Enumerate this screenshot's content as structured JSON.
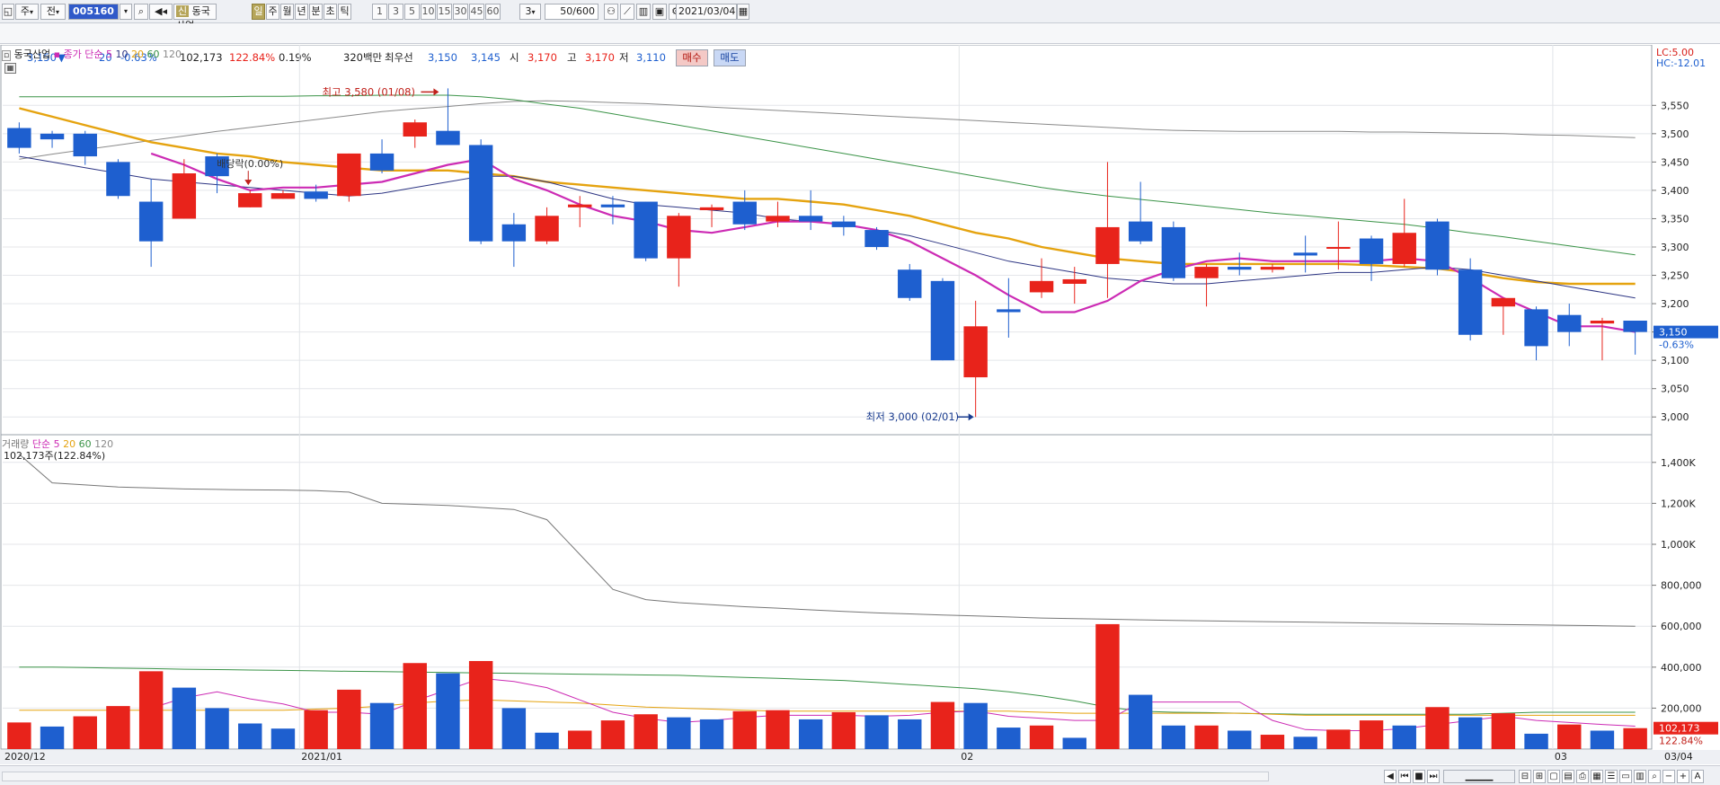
{
  "toolbar": {
    "mode_label": "주",
    "compare_label": "전",
    "stock_code": "005160",
    "sin_label": "신",
    "stock_name": "동국산업",
    "periods": [
      "일",
      "주",
      "월",
      "년",
      "분",
      "초",
      "틱"
    ],
    "active_period": "일",
    "intervals": [
      "1",
      "3",
      "5",
      "10",
      "15",
      "30",
      "45",
      "60"
    ],
    "interval_select": "3",
    "count_value": "50",
    "count_total": "/600",
    "date": "2021/03/04"
  },
  "quote": {
    "price": "3,150",
    "change_arrow": "▼",
    "change": "20",
    "change_pct": "-0.63%",
    "volume": "102,173",
    "volume_ratio": "122.84%",
    "turnover_rate": "0.19%",
    "amount": "320백만",
    "best_label": "최우선",
    "best_ask": "3,150",
    "best_bid": "3,145",
    "open_label": "시",
    "open": "3,170",
    "high_label": "고",
    "high": "3,170",
    "low_label": "저",
    "low": "3,110",
    "buy_label": "매수",
    "sell_label": "매도"
  },
  "price_panel": {
    "legend_name": "동국산업",
    "legend_type": "종가 단순",
    "ma_periods": [
      "5",
      "10",
      "20",
      "60",
      "120"
    ],
    "lc": "LC:5.00",
    "hc": "HC:-12.01",
    "current_price": "3,150",
    "current_change": "-0.63%",
    "high_annot": "최고 3,580 (01/08)",
    "low_annot": "최저 3,000 (02/01)",
    "ex_rights_annot": "배당락(0.00%)"
  },
  "volume_panel": {
    "legend_name": "거래량",
    "legend_type": "단순",
    "ma_periods": [
      "5",
      "20",
      "60",
      "120"
    ],
    "volume_info": "102,173주(122.84%)",
    "current_volume": "102,173",
    "current_ratio": "122.84%"
  },
  "x_axis": {
    "labels": [
      "2020/12",
      "2021/01",
      "02",
      "03"
    ],
    "end_label": "03/04"
  },
  "colors": {
    "up": "#e8231b",
    "down": "#1e5fcf",
    "ma5": "#cc2bb4",
    "ma10": "#2d3583",
    "ma20": "#e5a30f",
    "ma60": "#3a9347",
    "ma120": "#8a8a8a"
  },
  "chart_data": [
    {
      "type": "candlestick",
      "title": "동국산업",
      "ylim": [
        2975,
        3625
      ],
      "yticks": [
        3000,
        3050,
        3100,
        3150,
        3200,
        3250,
        3300,
        3350,
        3400,
        3450,
        3500,
        3550
      ],
      "candles": [
        {
          "o": 3510,
          "h": 3520,
          "l": 3465,
          "c": 3475
        },
        {
          "o": 3500,
          "h": 3505,
          "l": 3475,
          "c": 3490
        },
        {
          "o": 3500,
          "h": 3505,
          "l": 3445,
          "c": 3460
        },
        {
          "o": 3450,
          "h": 3455,
          "l": 3385,
          "c": 3390
        },
        {
          "o": 3380,
          "h": 3420,
          "l": 3265,
          "c": 3310
        },
        {
          "o": 3350,
          "h": 3455,
          "l": 3350,
          "c": 3430
        },
        {
          "o": 3460,
          "h": 3465,
          "l": 3395,
          "c": 3425
        },
        {
          "o": 3370,
          "h": 3400,
          "l": 3370,
          "c": 3395
        },
        {
          "o": 3385,
          "h": 3400,
          "l": 3385,
          "c": 3395
        },
        {
          "o": 3398,
          "h": 3410,
          "l": 3380,
          "c": 3385
        },
        {
          "o": 3390,
          "h": 3465,
          "l": 3380,
          "c": 3465
        },
        {
          "o": 3465,
          "h": 3490,
          "l": 3430,
          "c": 3435
        },
        {
          "o": 3495,
          "h": 3525,
          "l": 3475,
          "c": 3520
        },
        {
          "o": 3505,
          "h": 3580,
          "l": 3490,
          "c": 3480
        },
        {
          "o": 3480,
          "h": 3490,
          "l": 3305,
          "c": 3310
        },
        {
          "o": 3340,
          "h": 3360,
          "l": 3265,
          "c": 3310
        },
        {
          "o": 3310,
          "h": 3370,
          "l": 3305,
          "c": 3355
        },
        {
          "o": 3370,
          "h": 3390,
          "l": 3335,
          "c": 3375
        },
        {
          "o": 3375,
          "h": 3390,
          "l": 3340,
          "c": 3370
        },
        {
          "o": 3380,
          "h": 3380,
          "l": 3275,
          "c": 3280
        },
        {
          "o": 3280,
          "h": 3360,
          "l": 3230,
          "c": 3355
        },
        {
          "o": 3365,
          "h": 3375,
          "l": 3335,
          "c": 3370
        },
        {
          "o": 3380,
          "h": 3400,
          "l": 3330,
          "c": 3340
        },
        {
          "o": 3345,
          "h": 3380,
          "l": 3335,
          "c": 3355
        },
        {
          "o": 3355,
          "h": 3400,
          "l": 3330,
          "c": 3345
        },
        {
          "o": 3345,
          "h": 3355,
          "l": 3320,
          "c": 3335
        },
        {
          "o": 3330,
          "h": 3335,
          "l": 3295,
          "c": 3300
        },
        {
          "o": 3260,
          "h": 3270,
          "l": 3205,
          "c": 3210
        },
        {
          "o": 3240,
          "h": 3245,
          "l": 3100,
          "c": 3100
        },
        {
          "o": 3070,
          "h": 3205,
          "l": 3000,
          "c": 3160
        },
        {
          "o": 3190,
          "h": 3245,
          "l": 3140,
          "c": 3185
        },
        {
          "o": 3220,
          "h": 3280,
          "l": 3210,
          "c": 3240
        },
        {
          "o": 3235,
          "h": 3265,
          "l": 3200,
          "c": 3243
        },
        {
          "o": 3270,
          "h": 3450,
          "l": 3210,
          "c": 3335
        },
        {
          "o": 3345,
          "h": 3415,
          "l": 3305,
          "c": 3310
        },
        {
          "o": 3335,
          "h": 3345,
          "l": 3240,
          "c": 3245
        },
        {
          "o": 3245,
          "h": 3270,
          "l": 3195,
          "c": 3265
        },
        {
          "o": 3265,
          "h": 3290,
          "l": 3250,
          "c": 3260
        },
        {
          "o": 3260,
          "h": 3270,
          "l": 3255,
          "c": 3265
        },
        {
          "o": 3290,
          "h": 3320,
          "l": 3255,
          "c": 3285
        },
        {
          "o": 3300,
          "h": 3345,
          "l": 3260,
          "c": 3300
        },
        {
          "o": 3315,
          "h": 3320,
          "l": 3240,
          "c": 3270
        },
        {
          "o": 3270,
          "h": 3385,
          "l": 3265,
          "c": 3325
        },
        {
          "o": 3345,
          "h": 3350,
          "l": 3250,
          "c": 3260
        },
        {
          "o": 3260,
          "h": 3280,
          "l": 3135,
          "c": 3145
        },
        {
          "o": 3195,
          "h": 3210,
          "l": 3145,
          "c": 3210
        },
        {
          "o": 3190,
          "h": 3195,
          "l": 3100,
          "c": 3125
        },
        {
          "o": 3180,
          "h": 3200,
          "l": 3125,
          "c": 3150
        },
        {
          "o": 3165,
          "h": 3175,
          "l": 3100,
          "c": 3170
        },
        {
          "o": 3170,
          "h": 3170,
          "l": 3110,
          "c": 3150
        }
      ],
      "ma5": [
        null,
        null,
        null,
        null,
        3465,
        3445,
        3420,
        3400,
        3405,
        3405,
        3410,
        3415,
        3430,
        3445,
        3455,
        3420,
        3400,
        3375,
        3355,
        3345,
        3330,
        3325,
        3335,
        3345,
        3345,
        3340,
        3330,
        3310,
        3280,
        3250,
        3215,
        3185,
        3185,
        3205,
        3240,
        3260,
        3275,
        3280,
        3275,
        3275,
        3275,
        3275,
        3280,
        3275,
        3245,
        3210,
        3185,
        3160,
        3160,
        3150
      ],
      "ma10": [
        3460,
        3450,
        3440,
        3430,
        3420,
        3415,
        3410,
        3405,
        3400,
        3395,
        3390,
        3395,
        3405,
        3415,
        3425,
        3425,
        3415,
        3400,
        3385,
        3375,
        3370,
        3365,
        3360,
        3350,
        3345,
        3340,
        3330,
        3320,
        3305,
        3290,
        3275,
        3265,
        3255,
        3245,
        3240,
        3235,
        3235,
        3240,
        3245,
        3250,
        3255,
        3255,
        3260,
        3265,
        3260,
        3250,
        3240,
        3230,
        3220,
        3210
      ],
      "ma20": [
        3545,
        3530,
        3515,
        3500,
        3485,
        3475,
        3465,
        3460,
        3450,
        3445,
        3440,
        3435,
        3435,
        3435,
        3430,
        3425,
        3415,
        3410,
        3405,
        3400,
        3395,
        3390,
        3385,
        3385,
        3380,
        3375,
        3365,
        3355,
        3340,
        3325,
        3315,
        3300,
        3290,
        3280,
        3275,
        3270,
        3270,
        3270,
        3270,
        3270,
        3270,
        3268,
        3265,
        3262,
        3255,
        3245,
        3238,
        3235,
        3235,
        3235
      ],
      "ma60": [
        3565,
        3565,
        3565,
        3565,
        3565,
        3565,
        3565,
        3566,
        3566,
        3567,
        3567,
        3568,
        3568,
        3568,
        3565,
        3560,
        3552,
        3545,
        3535,
        3525,
        3515,
        3505,
        3495,
        3485,
        3475,
        3465,
        3455,
        3445,
        3435,
        3425,
        3415,
        3405,
        3397,
        3390,
        3384,
        3378,
        3372,
        3366,
        3360,
        3355,
        3350,
        3345,
        3340,
        3333,
        3325,
        3318,
        3310,
        3302,
        3294,
        3286
      ],
      "ma120": [
        3455,
        3464,
        3472,
        3480,
        3488,
        3496,
        3504,
        3511,
        3518,
        3525,
        3532,
        3539,
        3544,
        3548,
        3553,
        3557,
        3558,
        3557,
        3555,
        3553,
        3550,
        3547,
        3544,
        3541,
        3538,
        3535,
        3532,
        3529,
        3526,
        3523,
        3520,
        3517,
        3514,
        3511,
        3508,
        3506,
        3505,
        3504,
        3504,
        3504,
        3504,
        3503,
        3503,
        3502,
        3501,
        3500,
        3498,
        3497,
        3495,
        3493
      ]
    },
    {
      "type": "bar",
      "title": "거래량",
      "ylim": [
        0,
        1500000
      ],
      "yticks": [
        200000,
        400000,
        600000,
        800000,
        1000000,
        1200000,
        1400000
      ],
      "ytick_labels": [
        "200,000",
        "400,000",
        "600,000",
        "800,000",
        "1,000K",
        "1,200K",
        "1,400K"
      ],
      "values": [
        130000,
        110000,
        160000,
        210000,
        380000,
        300000,
        200000,
        125000,
        100000,
        190000,
        290000,
        225000,
        420000,
        370000,
        430000,
        200000,
        80000,
        90000,
        140000,
        170000,
        155000,
        145000,
        185000,
        190000,
        145000,
        180000,
        165000,
        145000,
        230000,
        225000,
        105000,
        115000,
        55000,
        610000,
        265000,
        115000,
        115000,
        90000,
        70000,
        60000,
        95000,
        140000,
        115000,
        205000,
        155000,
        175000,
        75000,
        120000,
        90000,
        102173
      ],
      "up": [
        true,
        false,
        true,
        true,
        true,
        false,
        false,
        false,
        false,
        true,
        true,
        false,
        true,
        false,
        true,
        false,
        false,
        true,
        true,
        true,
        false,
        false,
        true,
        true,
        false,
        true,
        false,
        false,
        true,
        false,
        false,
        true,
        false,
        true,
        false,
        false,
        true,
        false,
        true,
        false,
        true,
        true,
        false,
        true,
        false,
        true,
        false,
        true,
        false,
        true
      ],
      "ma5": [
        null,
        null,
        null,
        null,
        200000,
        250000,
        280000,
        245000,
        220000,
        180000,
        180000,
        170000,
        235000,
        290000,
        345000,
        330000,
        300000,
        240000,
        180000,
        150000,
        130000,
        140000,
        155000,
        165000,
        165000,
        165000,
        160000,
        165000,
        180000,
        185000,
        160000,
        150000,
        140000,
        140000,
        230000,
        230000,
        230000,
        230000,
        140000,
        95000,
        90000,
        90000,
        100000,
        120000,
        140000,
        160000,
        140000,
        130000,
        120000,
        112000
      ],
      "ma20": [
        190000,
        190000,
        190000,
        190000,
        190000,
        190000,
        190000,
        190000,
        190000,
        195000,
        200000,
        210000,
        225000,
        235000,
        240000,
        235000,
        230000,
        225000,
        215000,
        205000,
        200000,
        195000,
        190000,
        185000,
        185000,
        185000,
        185000,
        185000,
        185000,
        185000,
        185000,
        180000,
        175000,
        175000,
        175000,
        175000,
        175000,
        175000,
        170000,
        165000,
        165000,
        165000,
        165000,
        165000,
        165000,
        165000,
        165000,
        165000,
        165000,
        165000
      ],
      "ma60": [
        400000,
        400000,
        398000,
        395000,
        393000,
        390000,
        388000,
        386000,
        384000,
        382000,
        380000,
        378000,
        376000,
        374000,
        372000,
        370000,
        368000,
        366000,
        364000,
        362000,
        360000,
        355000,
        350000,
        345000,
        340000,
        335000,
        325000,
        315000,
        305000,
        295000,
        280000,
        260000,
        235000,
        205000,
        185000,
        180000,
        178000,
        175000,
        172000,
        170000,
        170000,
        170000,
        170000,
        170000,
        170000,
        175000,
        180000,
        180000,
        180000,
        180000
      ],
      "ma120": [
        1440000,
        1300000,
        1290000,
        1280000,
        1275000,
        1270000,
        1268000,
        1266000,
        1265000,
        1262000,
        1255000,
        1200000,
        1195000,
        1190000,
        1180000,
        1170000,
        1120000,
        950000,
        780000,
        730000,
        715000,
        705000,
        695000,
        688000,
        680000,
        672000,
        665000,
        660000,
        655000,
        650000,
        645000,
        640000,
        637000,
        634000,
        631000,
        628000,
        626000,
        624000,
        622000,
        620000,
        618000,
        616000,
        614000,
        612000,
        610000,
        608000,
        606000,
        604000,
        602000,
        600000
      ]
    }
  ]
}
